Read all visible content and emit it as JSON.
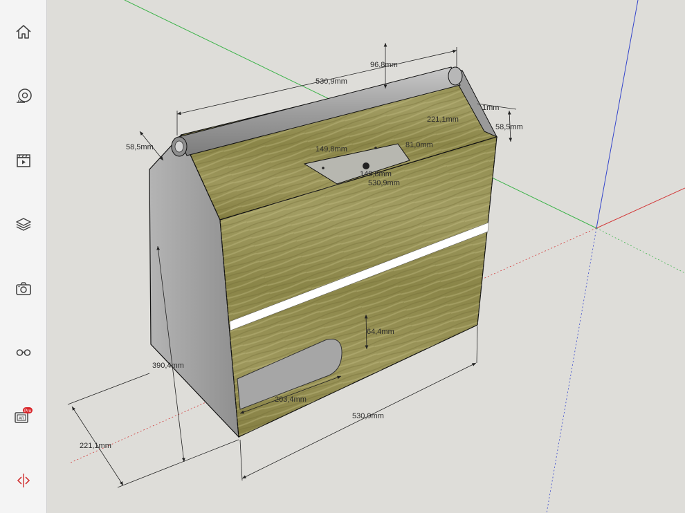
{
  "toolbar": {
    "items": [
      {
        "name": "home-icon"
      },
      {
        "name": "tape-measure-icon"
      },
      {
        "name": "scenes-icon"
      },
      {
        "name": "layers-icon"
      },
      {
        "name": "camera-icon"
      },
      {
        "name": "glasses-icon"
      },
      {
        "name": "ar-icon",
        "badge": "Pro",
        "label": "AR"
      },
      {
        "name": "section-plane-icon"
      }
    ]
  },
  "dimensions": {
    "top_length": "530,9mm",
    "handle_height": "96,8mm",
    "left_top_height": "58,5mm",
    "plate_width": "149,8mm",
    "plate_depth": "81,0mm",
    "plate_width_lower": "149,8mm",
    "top_length_lower": "530,9mm",
    "right_depth": "221,1mm",
    "right_offset": "1mm",
    "right_height": "58,5mm",
    "slot_height": "64,4mm",
    "cutout_width": "203,4mm",
    "total_height": "390,4mm",
    "bottom_length": "530,9mm",
    "bottom_depth": "221,1mm"
  },
  "colors": {
    "background": "#deddd9",
    "sidebar": "#f4f4f4",
    "wood": "#8d8a4e",
    "metal": "#a9a9a9",
    "axis_red": "#d23a3a",
    "axis_green": "#3db34a",
    "axis_blue": "#3344cc"
  }
}
